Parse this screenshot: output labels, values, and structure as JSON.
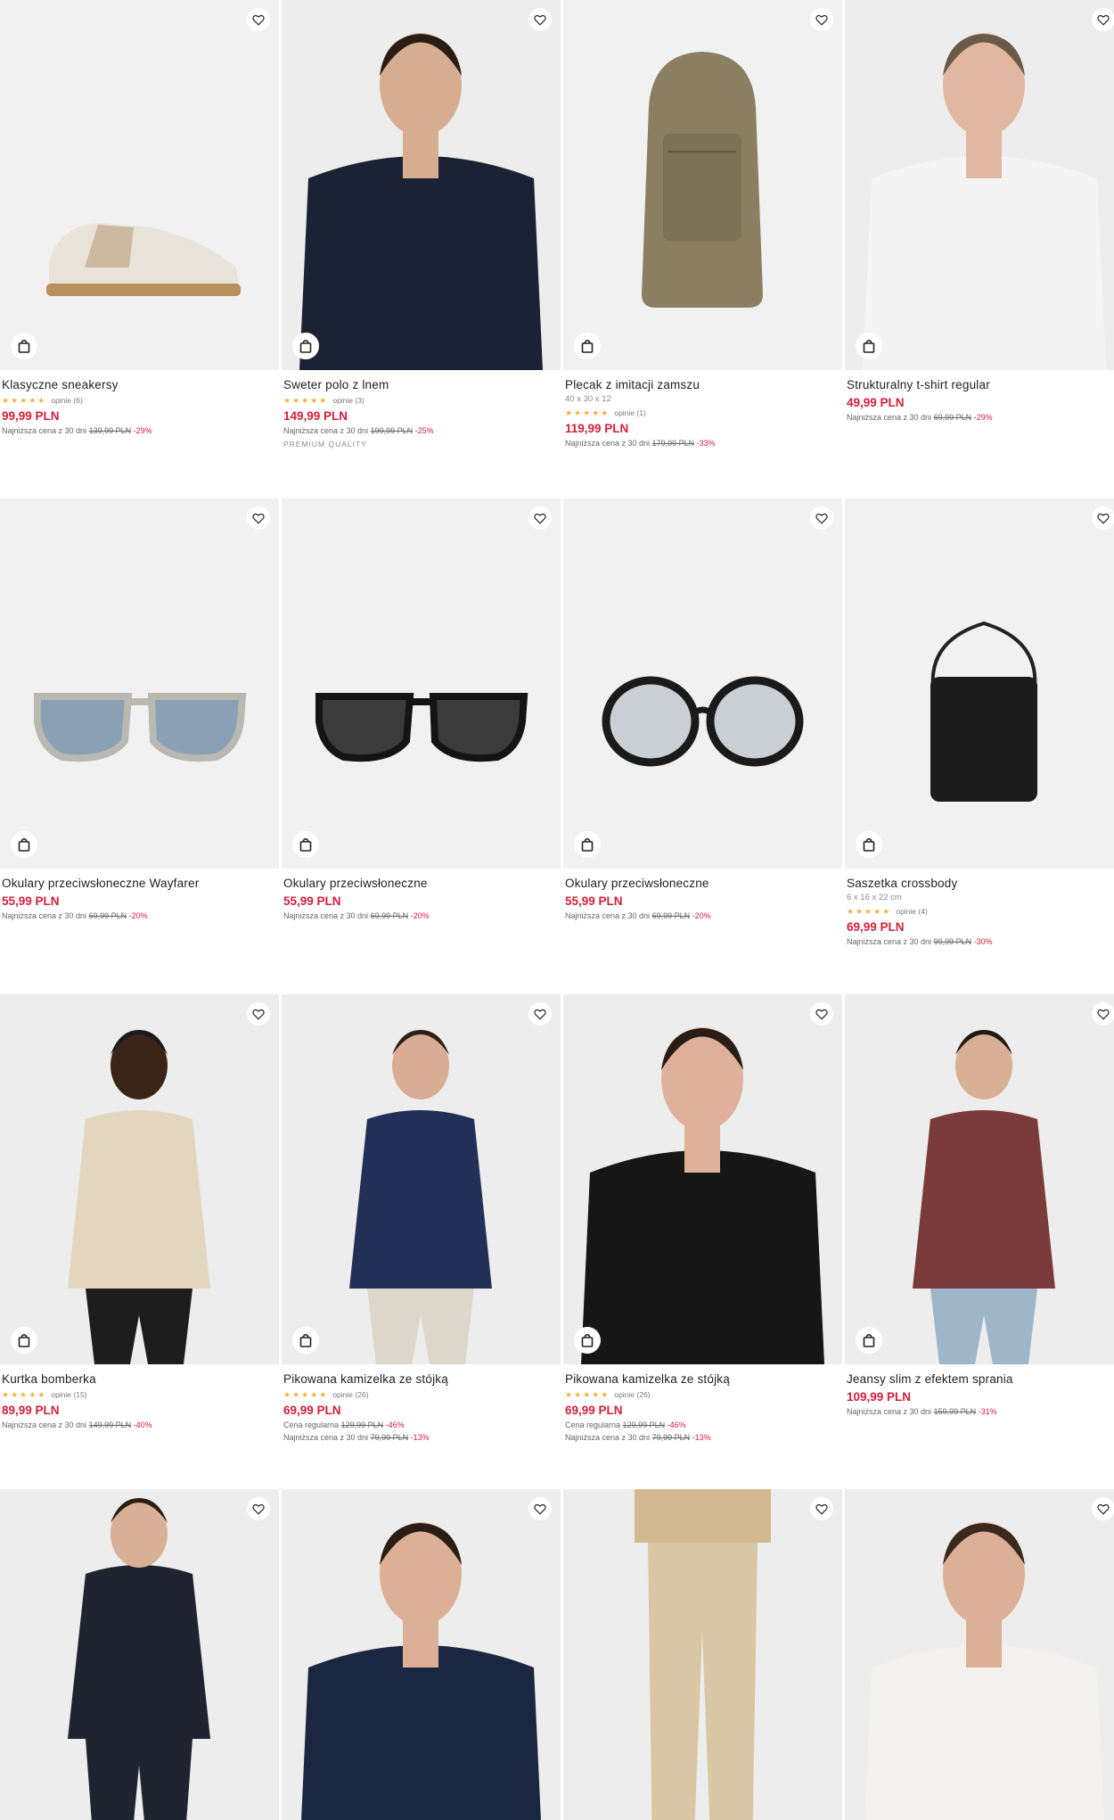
{
  "ui": {
    "accent": "#d3203a",
    "star_color": "#f0b43c",
    "icons": [
      "heart-icon",
      "shopping-bag-icon",
      "star-icon"
    ]
  },
  "products": [
    {
      "name": "Klasyczne sneakersy",
      "dims": "",
      "stars": "★★★★★",
      "reviews": "opinie (6)",
      "price": "99,99 PLN",
      "regular": null,
      "lowest": {
        "label": "Najniższa cena z 30 dni",
        "old": "139,99 PLN",
        "disc": "-29%"
      },
      "tag": ""
    },
    {
      "name": "Sweter polo z lnem",
      "dims": "",
      "stars": "★★★★★",
      "reviews": "opinie (3)",
      "price": "149,99 PLN",
      "regular": null,
      "lowest": {
        "label": "Najniższa cena z 30 dni",
        "old": "199,99 PLN",
        "disc": "-25%"
      },
      "tag": "PREMIUM QUALITY"
    },
    {
      "name": "Plecak z imitacji zamszu",
      "dims": "40 x 30 x 12",
      "stars": "★★★★★",
      "reviews": "opinie (1)",
      "price": "119,99 PLN",
      "regular": null,
      "lowest": {
        "label": "Najniższa cena z 30 dni",
        "old": "179,99 PLN",
        "disc": "-33%"
      },
      "tag": ""
    },
    {
      "name": "Strukturalny t-shirt regular",
      "dims": "",
      "stars": "",
      "reviews": "",
      "price": "49,99 PLN",
      "regular": null,
      "lowest": {
        "label": "Najniższa cena z 30 dni",
        "old": "69,99 PLN",
        "disc": "-29%"
      },
      "tag": ""
    },
    {
      "name": "Okulary przeciwsłoneczne Wayfarer",
      "dims": "",
      "stars": "",
      "reviews": "",
      "price": "55,99 PLN",
      "regular": null,
      "lowest": {
        "label": "Najniższa cena z 30 dni",
        "old": "69,99 PLN",
        "disc": "-20%"
      },
      "tag": ""
    },
    {
      "name": "Okulary przeciwsłoneczne",
      "dims": "",
      "stars": "",
      "reviews": "",
      "price": "55,99 PLN",
      "regular": null,
      "lowest": {
        "label": "Najniższa cena z 30 dni",
        "old": "69,99 PLN",
        "disc": "-20%"
      },
      "tag": ""
    },
    {
      "name": "Okulary przeciwsłoneczne",
      "dims": "",
      "stars": "",
      "reviews": "",
      "price": "55,99 PLN",
      "regular": null,
      "lowest": {
        "label": "Najniższa cena z 30 dni",
        "old": "69,99 PLN",
        "disc": "-20%"
      },
      "tag": ""
    },
    {
      "name": "Saszetka crossbody",
      "dims": "6 x 16 x 22 cm",
      "stars": "★★★★★",
      "reviews": "opinie (4)",
      "price": "69,99 PLN",
      "regular": null,
      "lowest": {
        "label": "Najniższa cena z 30 dni",
        "old": "99,99 PLN",
        "disc": "-30%"
      },
      "tag": ""
    },
    {
      "name": "Kurtka bomberka",
      "dims": "",
      "stars": "★★★★★",
      "reviews": "opinie (15)",
      "price": "89,99 PLN",
      "regular": null,
      "lowest": {
        "label": "Najniższa cena z 30 dni",
        "old": "149,99 PLN",
        "disc": "-40%"
      },
      "tag": ""
    },
    {
      "name": "Pikowana kamizelka ze stójką",
      "dims": "",
      "stars": "★★★★★",
      "reviews": "opinie (26)",
      "price": "69,99 PLN",
      "regular": {
        "label": "Cena regularna",
        "old": "129,99 PLN",
        "disc": "-46%"
      },
      "lowest": {
        "label": "Najniższa cena z 30 dni",
        "old": "79,99 PLN",
        "disc": "-13%"
      },
      "tag": ""
    },
    {
      "name": "Pikowana kamizelka ze stójką",
      "dims": "",
      "stars": "★★★★★",
      "reviews": "opinie (26)",
      "price": "69,99 PLN",
      "regular": {
        "label": "Cena regularna",
        "old": "129,99 PLN",
        "disc": "-46%"
      },
      "lowest": {
        "label": "Najniższa cena z 30 dni",
        "old": "79,99 PLN",
        "disc": "-13%"
      },
      "tag": ""
    },
    {
      "name": "Jeansy slim z efektem sprania",
      "dims": "",
      "stars": "",
      "reviews": "",
      "price": "109,99 PLN",
      "regular": null,
      "lowest": {
        "label": "Najniższa cena z 30 dni",
        "old": "159,99 PLN",
        "disc": "-31%"
      },
      "tag": ""
    },
    {
      "name": "",
      "dims": "",
      "stars": "",
      "reviews": "",
      "price": "",
      "regular": null,
      "lowest": null,
      "tag": ""
    },
    {
      "name": "",
      "dims": "",
      "stars": "",
      "reviews": "",
      "price": "",
      "regular": null,
      "lowest": null,
      "tag": ""
    },
    {
      "name": "",
      "dims": "",
      "stars": "",
      "reviews": "",
      "price": "",
      "regular": null,
      "lowest": null,
      "tag": ""
    },
    {
      "name": "",
      "dims": "",
      "stars": "",
      "reviews": "",
      "price": "",
      "regular": null,
      "lowest": null,
      "tag": ""
    }
  ]
}
